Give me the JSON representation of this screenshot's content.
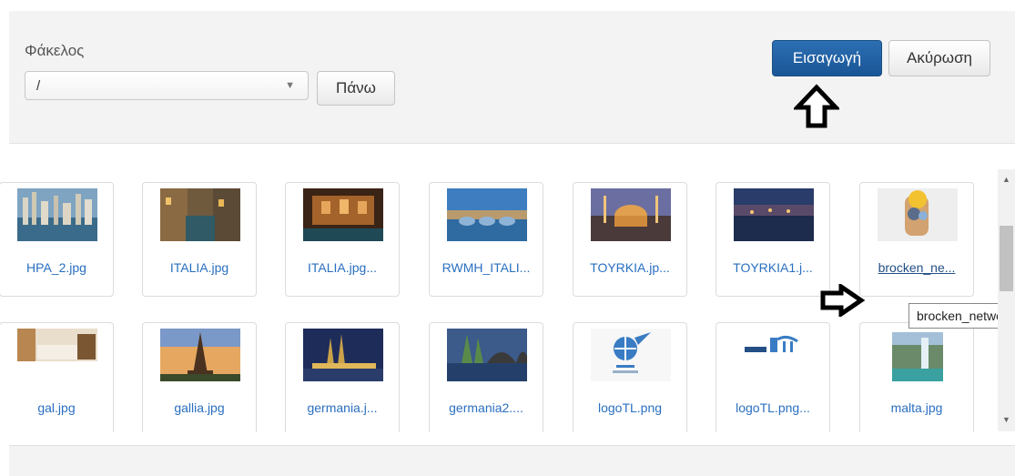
{
  "toolbar": {
    "folder_label": "Φάκελος",
    "folder_value": "/",
    "up_button": "Πάνω",
    "insert_button": "Εισαγωγή",
    "cancel_button": "Ακύρωση"
  },
  "files": [
    {
      "name": "HPA_2.jpg",
      "thumb": "city-skyline"
    },
    {
      "name": "ITALIA.jpg",
      "thumb": "canal"
    },
    {
      "name": "ITALIA.jpg...",
      "thumb": "night-fountain"
    },
    {
      "name": "RWMH_ITALI...",
      "thumb": "river-bridge"
    },
    {
      "name": "TOYRKIA.jp...",
      "thumb": "mosque"
    },
    {
      "name": "TOYRKIA1.j...",
      "thumb": "bosphorus"
    },
    {
      "name": "brocken_ne...",
      "thumb": "broken-network",
      "hovered": true
    },
    {
      "name": "gal.jpg",
      "thumb": "hotel-room"
    },
    {
      "name": "gallia.jpg",
      "thumb": "eiffel-tower"
    },
    {
      "name": "germania.j...",
      "thumb": "cologne-night"
    },
    {
      "name": "germania2....",
      "thumb": "cologne-bridge"
    },
    {
      "name": "logoTL.png",
      "thumb": "globe-logo"
    },
    {
      "name": "logoTL.png...",
      "thumb": "union-logo"
    },
    {
      "name": "malta.jpg",
      "thumb": "waterfall"
    }
  ],
  "tooltip": "brocken_netwo",
  "annotations": [
    "arrow-up-icon",
    "arrow-right-icon"
  ],
  "colors": {
    "primary": "#1f5ea3",
    "link": "#2a6fc0"
  }
}
